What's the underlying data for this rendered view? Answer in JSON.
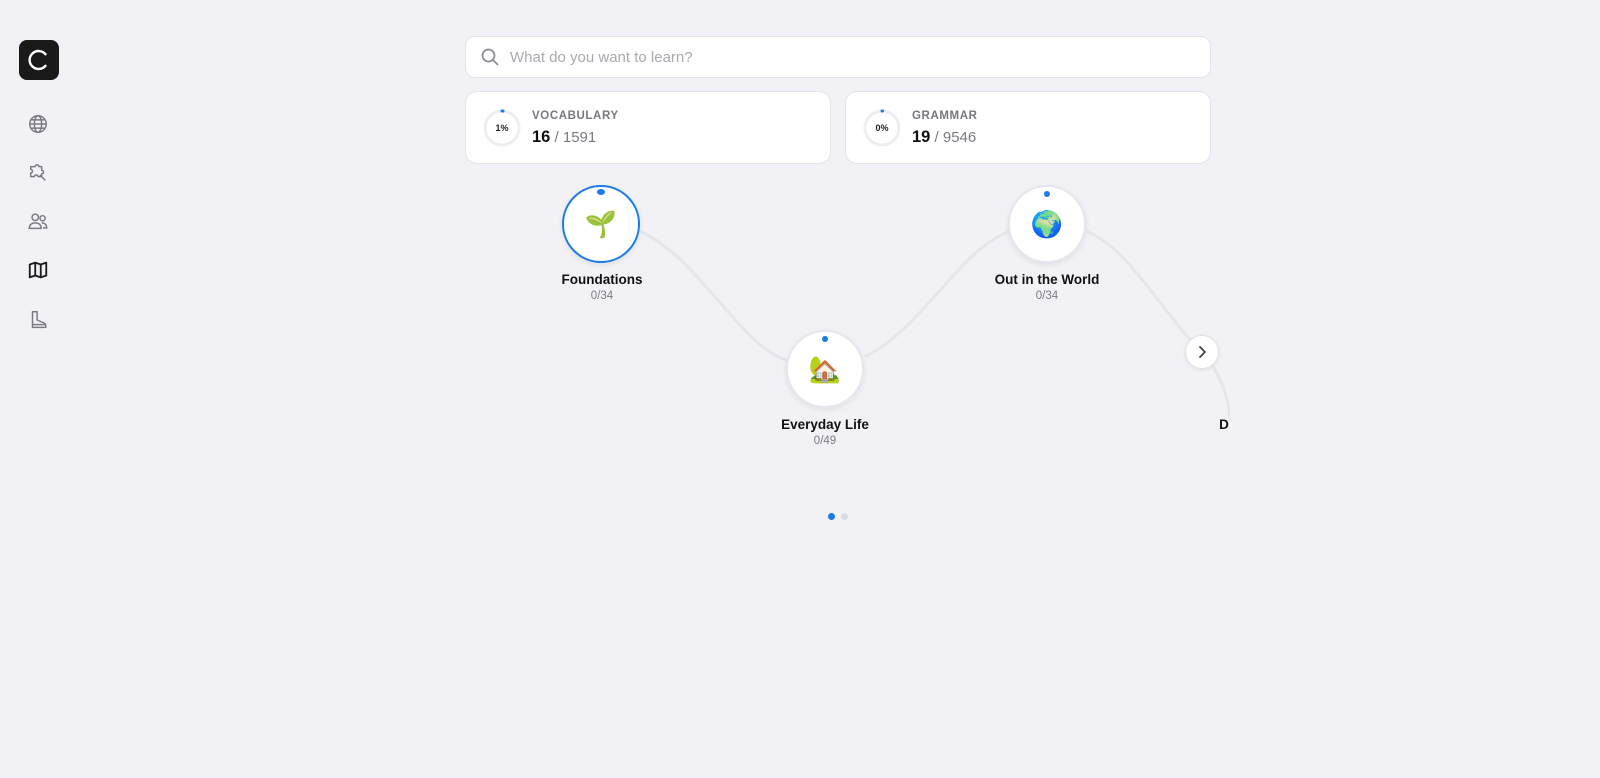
{
  "app": {
    "logo_letter": "C"
  },
  "sidebar": {
    "items": [
      {
        "icon": "globe-icon",
        "active": false
      },
      {
        "icon": "puzzle-icon",
        "active": false
      },
      {
        "icon": "users-icon",
        "active": false
      },
      {
        "icon": "map-icon",
        "active": true
      },
      {
        "icon": "boot-icon",
        "active": false
      }
    ]
  },
  "search": {
    "placeholder": "What do you want to learn?",
    "value": ""
  },
  "stats": {
    "vocabulary": {
      "label": "VOCABULARY",
      "percent": "1%",
      "progress": 0.01,
      "done": "16",
      "total": "/ 1591"
    },
    "grammar": {
      "label": "GRAMMAR",
      "percent": "0%",
      "progress": 0.0,
      "done": "19",
      "total": "/ 9546"
    }
  },
  "path": {
    "nodes": [
      {
        "title": "Foundations",
        "count": "0/34",
        "emoji": "🌱",
        "active": true
      },
      {
        "title": "Everyday Life",
        "count": "0/49",
        "emoji": "🏡",
        "active": false
      },
      {
        "title": "Out in the World",
        "count": "0/34",
        "emoji": "🌍",
        "active": false
      },
      {
        "title": "D",
        "count": "",
        "emoji": "",
        "active": false
      }
    ],
    "next_icon": "chevron-right-icon"
  },
  "pager": {
    "pages": 2,
    "current": 1
  },
  "colors": {
    "accent": "#1a7be6",
    "background": "#f2f2f6"
  }
}
